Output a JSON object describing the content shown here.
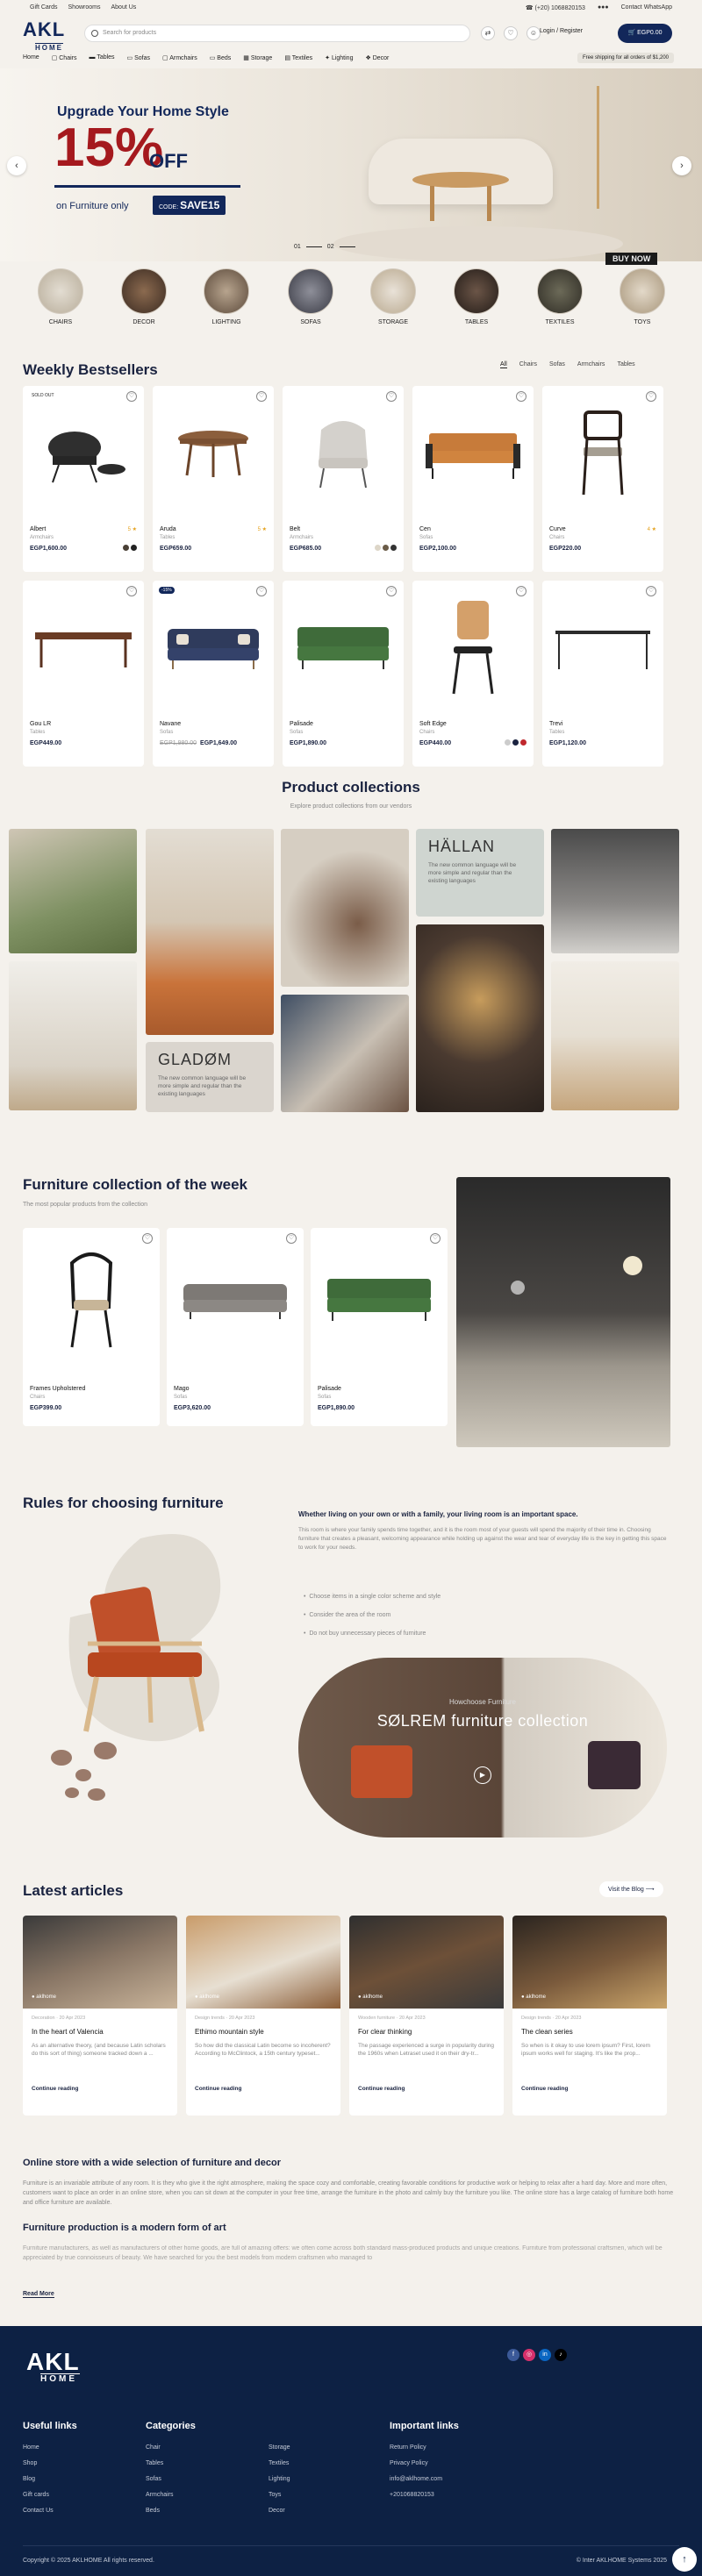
{
  "topbar": {
    "left": [
      "Gift Cards",
      "Showrooms",
      "About Us"
    ],
    "phone": "(+20) 1068820153",
    "whatsapp": "Contact WhatsApp"
  },
  "header": {
    "logo_big": "AKL",
    "logo_small": "HOME",
    "search_placeholder": "Search for products",
    "login": "Login / Register",
    "cart_total": "EGP0.00"
  },
  "nav": {
    "items": [
      "Home",
      "Chairs",
      "Tables",
      "Sofas",
      "Armchairs",
      "Beds",
      "Storage",
      "Textiles",
      "Lighting",
      "Decor"
    ],
    "shipping": "Free shipping for all orders of $1,200"
  },
  "hero": {
    "headline": "Upgrade Your Home Style",
    "percent": "15%",
    "off": "OFF",
    "subline": "on Furniture only",
    "code_label": "CODE:",
    "code": "SAVE15",
    "slide_1": "01",
    "slide_2": "02",
    "badge": "BUY NOW"
  },
  "categories": [
    "CHAIRS",
    "DECOR",
    "LIGHTING",
    "SOFAS",
    "STORAGE",
    "TABLES",
    "TEXTILES",
    "TOYS"
  ],
  "bestsellers": {
    "title": "Weekly Bestsellers",
    "tabs": [
      "All",
      "Chairs",
      "Sofas",
      "Armchairs",
      "Tables"
    ],
    "products": [
      {
        "name": "Albert",
        "category": "Armchairs",
        "price": "EGP1,600.00",
        "tag": "SOLD OUT",
        "rating": "5 ★"
      },
      {
        "name": "Aruda",
        "category": "Tables",
        "price": "EGP659.00",
        "rating": "5 ★"
      },
      {
        "name": "Belt",
        "category": "Armchairs",
        "price": "EGP685.00"
      },
      {
        "name": "Cen",
        "category": "Sofas",
        "price": "EGP2,100.00"
      },
      {
        "name": "Curve",
        "category": "Chairs",
        "price": "EGP220.00",
        "rating": "4 ★"
      },
      {
        "name": "Gou LR",
        "category": "Tables",
        "price": "EGP449.00"
      },
      {
        "name": "Navane",
        "category": "Sofas",
        "price": "EGP1,649.00",
        "old_price": "EGP1,980.00",
        "tag": "-15%"
      },
      {
        "name": "Palisade",
        "category": "Sofas",
        "price": "EGP1,890.00"
      },
      {
        "name": "Soft Edge",
        "category": "Chairs",
        "price": "EGP440.00"
      },
      {
        "name": "Trevi",
        "category": "Tables",
        "price": "EGP1,120.00"
      }
    ]
  },
  "collections": {
    "title": "Product collections",
    "subtitle": "Explore product collections from our vendors",
    "hallan_title": "HÄLLAN",
    "hallan_text": "The new common language will be more simple and regular than the existing languages",
    "gladom_title": "GLADØM",
    "gladom_text": "The new common language will be more simple and regular than the existing languages"
  },
  "week": {
    "title": "Furniture collection of the week",
    "subtitle": "The most popular products from the collection",
    "products": [
      {
        "name": "Frames Upholstered",
        "category": "Chairs",
        "price": "EGP399.00"
      },
      {
        "name": "Mago",
        "category": "Sofas",
        "price": "EGP3,620.00"
      },
      {
        "name": "Palisade",
        "category": "Sofas",
        "price": "EGP1,890.00"
      }
    ]
  },
  "rules": {
    "title": "Rules for choosing furniture",
    "heading": "Whether living on your own or with a family, your living room is an important space.",
    "paragraph": "This room is where your family spends time together, and it is the room most of your guests will spend the majority of their time in. Choosing furniture that creates a pleasant, welcoming appearance while holding up against the wear and tear of everyday life is the key in getting this space to work for your needs.",
    "list": [
      "Choose items in a single color scheme and style",
      "Consider the area of the room",
      "Do not buy unnecessary pieces of furniture"
    ],
    "banner_sub": "Howchoose Furniture",
    "banner_title": "SØLREM furniture collection"
  },
  "articles": {
    "title": "Latest articles",
    "visit": "Visit the Blog ⟶",
    "items": [
      {
        "meta": "Decoration  ·  20 Apr 2023",
        "title": "In the heart of Valencia",
        "excerpt": "As an alternative theory, (and because Latin scholars do this sort of thing) someone tracked down a ...",
        "author": "aklhome"
      },
      {
        "meta": "Design trends  ·  20 Apr 2023",
        "title": "Ethimo mountain style",
        "excerpt": "So how did the classical Latin become so incoherent? According to McClintock, a 15th century typeset...",
        "author": "aklhome"
      },
      {
        "meta": "Wooden furniture  ·  20 Apr 2023",
        "title": "For clear thinking",
        "excerpt": "The passage experienced a surge in popularity during the 1960s when Letraset used it on their dry-tr...",
        "author": "aklhome"
      },
      {
        "meta": "Design trends  ·  20 Apr 2023",
        "title": "The clean series",
        "excerpt": "So when is it okay to use lorem ipsum? First, lorem ipsum works well for staging. It's like the prop...",
        "author": "aklhome"
      }
    ],
    "cta": "Continue reading"
  },
  "seo": {
    "h1": "Online store with a wide selection of furniture and decor",
    "p1": "Furniture is an invariable attribute of any room. It is they who give it the right atmosphere, making the space cozy and comfortable, creating favorable conditions for productive work or helping to relax after a hard day. More and more often, customers want to place an order in an online store, when you can sit down at the computer in your free time, arrange the furniture in the photo and calmly buy the furniture you like. The online store has a large catalog of furniture both home and office furniture are available.",
    "h2": "Furniture production is a modern form of art",
    "p2": "Furniture manufacturers, as well as manufacturers of other home goods, are full of amazing offers: we often come across both standard mass-produced products and unique creations. Furniture from professional craftsmen, which will be appreciated by true connoisseurs of beauty. We have searched for you the best models from modern craftsmen who managed to",
    "read_more": "Read More"
  },
  "footer": {
    "logo_big": "AKL",
    "logo_small": "HOME",
    "useful_title": "Useful links",
    "useful": [
      "Home",
      "Shop",
      "Blog",
      "Gift cards",
      "Contact Us"
    ],
    "categories_title": "Categories",
    "categories_col1": [
      "Chair",
      "Tables",
      "Sofas",
      "Armchairs",
      "Beds"
    ],
    "categories_col2": [
      "Storage",
      "Textiles",
      "Lighting",
      "Toys",
      "Decor"
    ],
    "important_title": "Important links",
    "important": [
      "Return Policy",
      "Privacy Policy",
      "info@aklhome.com",
      "+201068820153"
    ],
    "copyright": "Copyright © 2025 AKLHOME All rights reserved.",
    "credit": "© Inter AKLHOME Systems 2025",
    "social": [
      "f",
      "◎",
      "in",
      "♪"
    ]
  },
  "colors": {
    "brand": "#12275a",
    "accent": "#a5191e",
    "footer": "#0d2144"
  }
}
